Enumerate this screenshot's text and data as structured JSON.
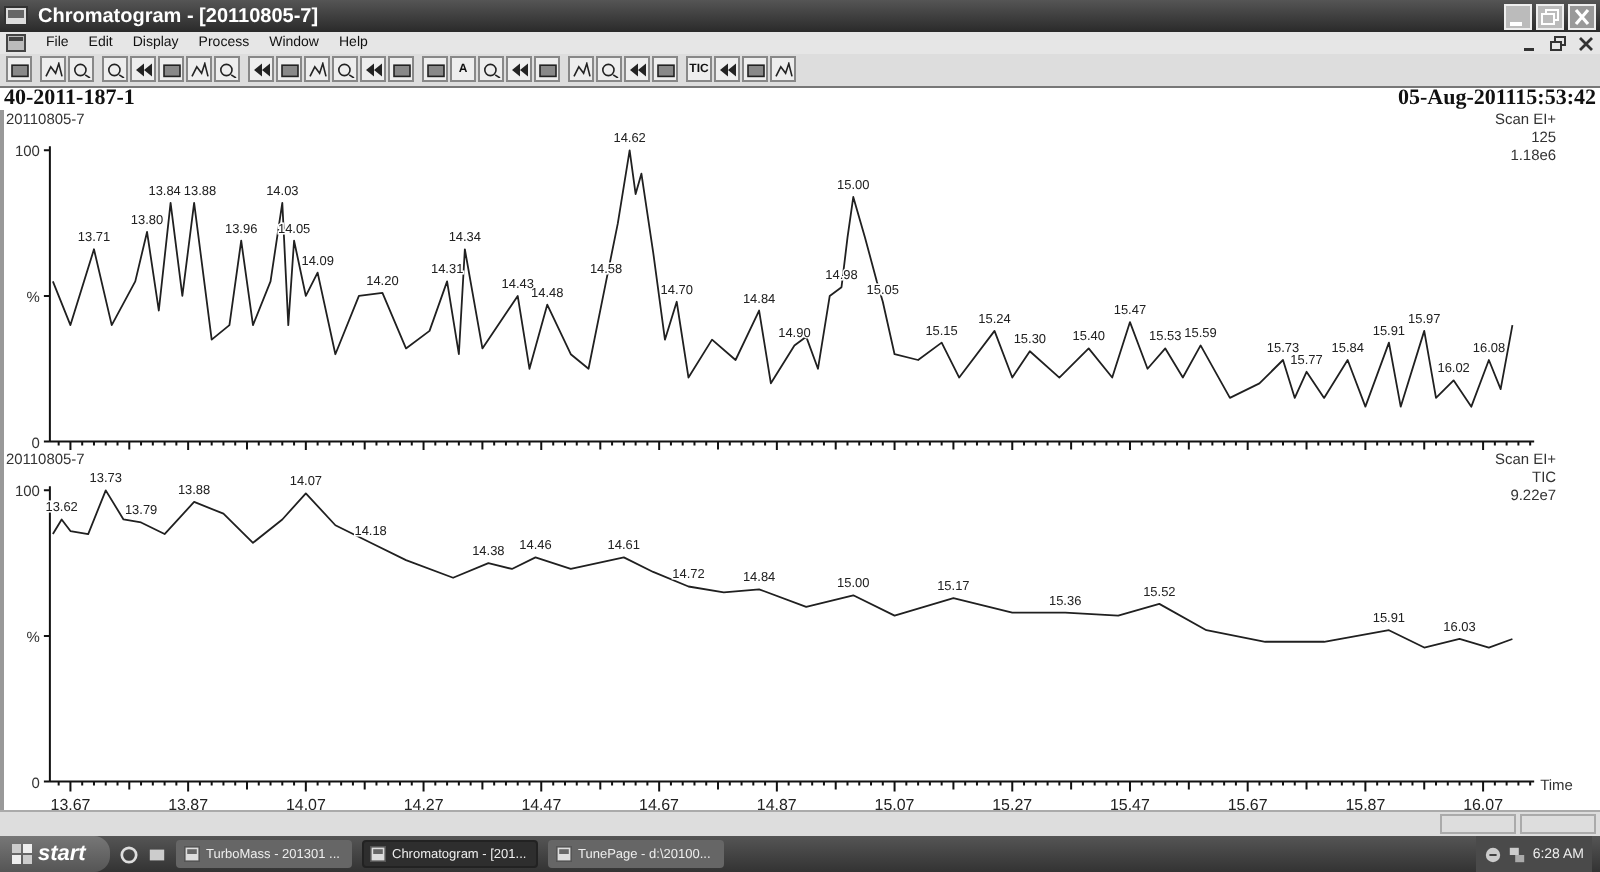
{
  "window": {
    "title": "Chromatogram - [20110805-7]"
  },
  "menu": [
    "File",
    "Edit",
    "Display",
    "Process",
    "Window",
    "Help"
  ],
  "toolbar": {
    "groups": [
      [
        {
          "kind": "icon"
        }
      ],
      [
        {
          "kind": "icon"
        },
        {
          "kind": "icon"
        }
      ],
      [
        {
          "kind": "icon"
        },
        {
          "kind": "icon"
        },
        {
          "kind": "icon"
        },
        {
          "kind": "icon"
        },
        {
          "kind": "icon"
        }
      ],
      [
        {
          "kind": "icon"
        },
        {
          "kind": "icon"
        },
        {
          "kind": "icon"
        },
        {
          "kind": "icon"
        },
        {
          "kind": "icon"
        },
        {
          "kind": "icon"
        }
      ],
      [
        {
          "kind": "icon"
        },
        {
          "kind": "text",
          "label": "A"
        },
        {
          "kind": "icon"
        },
        {
          "kind": "icon"
        },
        {
          "kind": "icon"
        }
      ],
      [
        {
          "kind": "icon"
        },
        {
          "kind": "icon"
        },
        {
          "kind": "icon"
        },
        {
          "kind": "icon"
        }
      ],
      [
        {
          "kind": "text",
          "label": "TIC"
        },
        {
          "kind": "icon"
        },
        {
          "kind": "icon"
        },
        {
          "kind": "icon"
        }
      ]
    ]
  },
  "header": {
    "sample_id": "40-2011-187-1",
    "acquired": "05-Aug-201115:53:42"
  },
  "plots": [
    {
      "sample": "20110805-7",
      "info": [
        "Scan EI+",
        "125",
        "1.18e6"
      ],
      "chart_data": {
        "type": "line",
        "xlim": [
          13.635,
          16.15
        ],
        "ylim": [
          0,
          100
        ],
        "yticks": [
          {
            "value": 0,
            "label": "0"
          },
          {
            "value": 50,
            "label": "%"
          },
          {
            "value": 100,
            "label": "100"
          }
        ],
        "x": [
          13.64,
          13.67,
          13.71,
          13.74,
          13.78,
          13.8,
          13.82,
          13.84,
          13.86,
          13.88,
          13.91,
          13.94,
          13.96,
          13.98,
          14.01,
          14.03,
          14.04,
          14.05,
          14.07,
          14.09,
          14.12,
          14.16,
          14.2,
          14.24,
          14.28,
          14.31,
          14.33,
          14.34,
          14.37,
          14.43,
          14.45,
          14.48,
          14.52,
          14.55,
          14.58,
          14.6,
          14.62,
          14.63,
          14.64,
          14.66,
          14.68,
          14.7,
          14.72,
          14.76,
          14.8,
          14.84,
          14.86,
          14.9,
          14.92,
          14.94,
          14.96,
          14.98,
          14.99,
          15.0,
          15.02,
          15.04,
          15.05,
          15.07,
          15.11,
          15.15,
          15.18,
          15.24,
          15.27,
          15.3,
          15.35,
          15.4,
          15.44,
          15.47,
          15.5,
          15.53,
          15.56,
          15.59,
          15.64,
          15.69,
          15.73,
          15.75,
          15.77,
          15.8,
          15.84,
          15.87,
          15.91,
          15.93,
          15.97,
          15.99,
          16.02,
          16.05,
          16.08,
          16.1,
          16.12
        ],
        "series": [
          {
            "color": "#202020",
            "values": [
              55,
              40,
              66,
              40,
              55,
              72,
              45,
              82,
              50,
              82,
              35,
              40,
              69,
              40,
              55,
              82,
              40,
              69,
              50,
              58,
              30,
              50,
              51,
              32,
              38,
              55,
              30,
              66,
              32,
              50,
              25,
              47,
              30,
              25,
              55,
              75,
              100,
              85,
              92,
              65,
              35,
              48,
              22,
              35,
              28,
              45,
              20,
              33,
              36,
              25,
              50,
              53,
              70,
              84,
              70,
              55,
              48,
              30,
              28,
              34,
              22,
              38,
              22,
              31,
              22,
              32,
              22,
              41,
              25,
              32,
              22,
              33,
              15,
              20,
              28,
              15,
              24,
              15,
              28,
              12,
              34,
              12,
              38,
              15,
              21,
              12,
              28,
              18,
              40
            ]
          }
        ],
        "annotations": [
          {
            "x": 13.71,
            "y": 66,
            "text": "13.71"
          },
          {
            "x": 13.8,
            "y": 72,
            "text": "13.80"
          },
          {
            "x": 13.83,
            "y": 82,
            "text": "13.84"
          },
          {
            "x": 13.89,
            "y": 82,
            "text": "13.88"
          },
          {
            "x": 13.96,
            "y": 69,
            "text": "13.96"
          },
          {
            "x": 14.03,
            "y": 82,
            "text": "14.03"
          },
          {
            "x": 14.05,
            "y": 69,
            "text": "14.05"
          },
          {
            "x": 14.09,
            "y": 58,
            "text": "14.09"
          },
          {
            "x": 14.2,
            "y": 51,
            "text": "14.20"
          },
          {
            "x": 14.31,
            "y": 55,
            "text": "14.31"
          },
          {
            "x": 14.34,
            "y": 66,
            "text": "14.34"
          },
          {
            "x": 14.43,
            "y": 50,
            "text": "14.43"
          },
          {
            "x": 14.48,
            "y": 47,
            "text": "14.48"
          },
          {
            "x": 14.58,
            "y": 55,
            "text": "14.58"
          },
          {
            "x": 14.62,
            "y": 100,
            "text": "14.62"
          },
          {
            "x": 14.7,
            "y": 48,
            "text": "14.70"
          },
          {
            "x": 14.84,
            "y": 45,
            "text": "14.84"
          },
          {
            "x": 14.9,
            "y": 33,
            "text": "14.90"
          },
          {
            "x": 14.98,
            "y": 53,
            "text": "14.98"
          },
          {
            "x": 15.0,
            "y": 84,
            "text": "15.00"
          },
          {
            "x": 15.05,
            "y": 48,
            "text": "15.05"
          },
          {
            "x": 15.15,
            "y": 34,
            "text": "15.15"
          },
          {
            "x": 15.24,
            "y": 38,
            "text": "15.24"
          },
          {
            "x": 15.3,
            "y": 31,
            "text": "15.30"
          },
          {
            "x": 15.4,
            "y": 32,
            "text": "15.40"
          },
          {
            "x": 15.47,
            "y": 41,
            "text": "15.47"
          },
          {
            "x": 15.53,
            "y": 32,
            "text": "15.53"
          },
          {
            "x": 15.59,
            "y": 33,
            "text": "15.59"
          },
          {
            "x": 15.73,
            "y": 28,
            "text": "15.73"
          },
          {
            "x": 15.77,
            "y": 24,
            "text": "15.77"
          },
          {
            "x": 15.84,
            "y": 28,
            "text": "15.84"
          },
          {
            "x": 15.91,
            "y": 34,
            "text": "15.91"
          },
          {
            "x": 15.97,
            "y": 38,
            "text": "15.97"
          },
          {
            "x": 16.02,
            "y": 21,
            "text": "16.02"
          },
          {
            "x": 16.08,
            "y": 28,
            "text": "16.08"
          }
        ]
      }
    },
    {
      "sample": "20110805-7",
      "info": [
        "Scan EI+",
        "TIC",
        "9.22e7"
      ],
      "chart_data": {
        "type": "line",
        "xlabel": "Time",
        "xlim": [
          13.635,
          16.15
        ],
        "ylim": [
          0,
          100
        ],
        "yticks": [
          {
            "value": 0,
            "label": "0"
          },
          {
            "value": 50,
            "label": "%"
          },
          {
            "value": 100,
            "label": "100"
          }
        ],
        "xticks": [
          {
            "value": 13.67,
            "label": "13.67"
          },
          {
            "value": 13.87,
            "label": "13.87"
          },
          {
            "value": 14.07,
            "label": "14.07"
          },
          {
            "value": 14.27,
            "label": "14.27"
          },
          {
            "value": 14.47,
            "label": "14.47"
          },
          {
            "value": 14.67,
            "label": "14.67"
          },
          {
            "value": 14.87,
            "label": "14.87"
          },
          {
            "value": 15.07,
            "label": "15.07"
          },
          {
            "value": 15.27,
            "label": "15.27"
          },
          {
            "value": 15.47,
            "label": "15.47"
          },
          {
            "value": 15.67,
            "label": "15.67"
          },
          {
            "value": 15.87,
            "label": "15.87"
          },
          {
            "value": 16.07,
            "label": "16.07"
          }
        ],
        "x": [
          13.64,
          13.655,
          13.67,
          13.7,
          13.73,
          13.76,
          13.79,
          13.83,
          13.88,
          13.93,
          13.98,
          14.03,
          14.07,
          14.12,
          14.18,
          14.24,
          14.32,
          14.38,
          14.42,
          14.46,
          14.52,
          14.61,
          14.66,
          14.72,
          14.78,
          14.84,
          14.92,
          15.0,
          15.07,
          15.17,
          15.27,
          15.36,
          15.45,
          15.52,
          15.6,
          15.7,
          15.8,
          15.91,
          15.97,
          16.03,
          16.08,
          16.12
        ],
        "series": [
          {
            "color": "#202020",
            "values": [
              85,
              90,
              86,
              85,
              100,
              90,
              89,
              85,
              96,
              92,
              82,
              90,
              99,
              88,
              82,
              76,
              70,
              75,
              73,
              77,
              73,
              77,
              72,
              67,
              65,
              66,
              60,
              64,
              57,
              63,
              58,
              58,
              57,
              61,
              52,
              48,
              48,
              52,
              46,
              49,
              46,
              49
            ]
          }
        ],
        "annotations": [
          {
            "x": 13.655,
            "y": 90,
            "text": "13.62"
          },
          {
            "x": 13.73,
            "y": 100,
            "text": "13.73"
          },
          {
            "x": 13.79,
            "y": 89,
            "text": "13.79"
          },
          {
            "x": 13.88,
            "y": 96,
            "text": "13.88"
          },
          {
            "x": 14.07,
            "y": 99,
            "text": "14.07"
          },
          {
            "x": 14.18,
            "y": 82,
            "text": "14.18"
          },
          {
            "x": 14.38,
            "y": 75,
            "text": "14.38"
          },
          {
            "x": 14.46,
            "y": 77,
            "text": "14.46"
          },
          {
            "x": 14.61,
            "y": 77,
            "text": "14.61"
          },
          {
            "x": 14.72,
            "y": 67,
            "text": "14.72"
          },
          {
            "x": 14.84,
            "y": 66,
            "text": "14.84"
          },
          {
            "x": 15.0,
            "y": 64,
            "text": "15.00"
          },
          {
            "x": 15.17,
            "y": 63,
            "text": "15.17"
          },
          {
            "x": 15.36,
            "y": 58,
            "text": "15.36"
          },
          {
            "x": 15.52,
            "y": 61,
            "text": "15.52"
          },
          {
            "x": 15.91,
            "y": 52,
            "text": "15.91"
          },
          {
            "x": 16.03,
            "y": 49,
            "text": "16.03"
          }
        ]
      }
    }
  ],
  "taskbar": {
    "start": "start",
    "tasks": [
      {
        "label": "TurboMass - 201301 ...",
        "selected": false
      },
      {
        "label": "Chromatogram - [201...",
        "selected": true
      },
      {
        "label": "TunePage - d:\\20100...",
        "selected": false
      }
    ],
    "clock": "6:28 AM"
  }
}
